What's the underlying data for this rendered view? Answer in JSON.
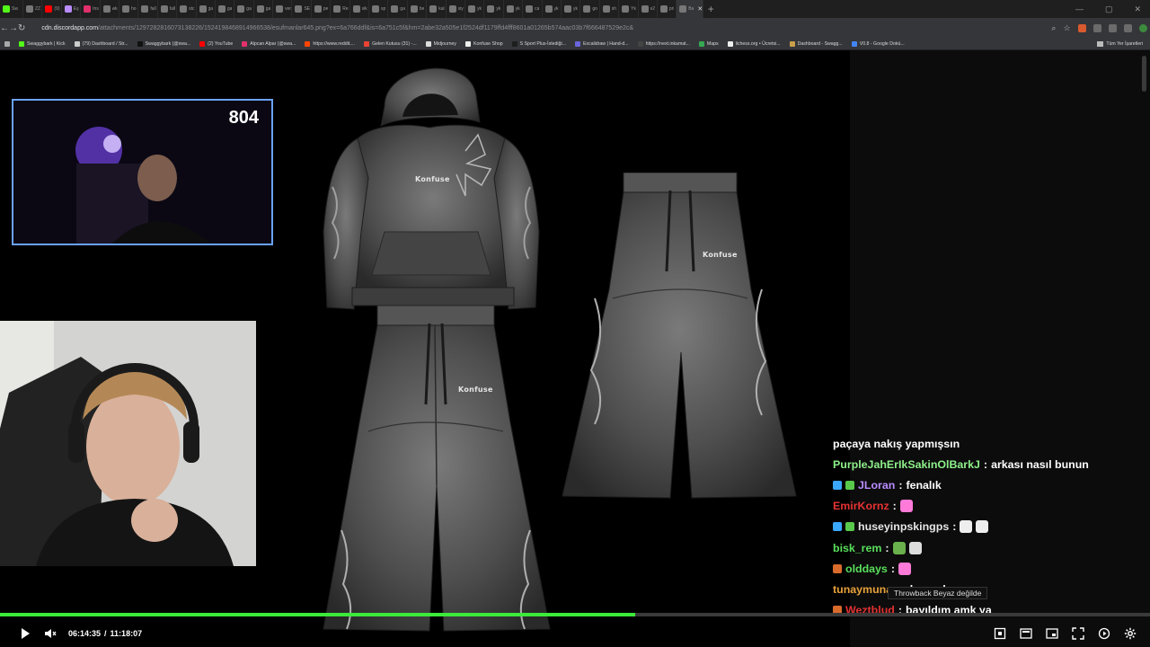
{
  "browser": {
    "tabs": [
      {
        "label": "Sw",
        "icon": "kick-icon",
        "color": "#53fc18"
      },
      {
        "label": "ZZ",
        "icon": "globe-icon",
        "color": "#777777"
      },
      {
        "label": "(9)",
        "icon": "youtube-icon",
        "color": "#ff0000"
      },
      {
        "label": "Eş",
        "icon": "feather-icon",
        "color": "#b98cff"
      },
      {
        "label": "Ins",
        "icon": "instagram-icon",
        "color": "#e1306c"
      },
      {
        "label": "wk",
        "icon": "globe-icon",
        "color": "#777777"
      },
      {
        "label": "ho",
        "icon": "globe-icon",
        "color": "#777777"
      },
      {
        "label": "fall",
        "icon": "globe-icon",
        "color": "#777777"
      },
      {
        "label": "fall",
        "icon": "globe-icon",
        "color": "#777777"
      },
      {
        "label": "stc",
        "icon": "globe-icon",
        "color": "#777777"
      },
      {
        "label": "ga",
        "icon": "globe-icon",
        "color": "#777777"
      },
      {
        "label": "ga",
        "icon": "globe-icon",
        "color": "#777777"
      },
      {
        "label": "ga",
        "icon": "globe-icon",
        "color": "#777777"
      },
      {
        "label": "ga",
        "icon": "globe-icon",
        "color": "#777777"
      },
      {
        "label": "ver",
        "icon": "globe-icon",
        "color": "#777777"
      },
      {
        "label": "SE",
        "icon": "globe-icon",
        "color": "#777777"
      },
      {
        "label": "pe",
        "icon": "globe-icon",
        "color": "#777777"
      },
      {
        "label": "Re",
        "icon": "globe-icon",
        "color": "#777777"
      },
      {
        "label": "sik",
        "icon": "globe-icon",
        "color": "#777777"
      },
      {
        "label": "sp",
        "icon": "globe-icon",
        "color": "#777777"
      },
      {
        "label": "ga",
        "icon": "globe-icon",
        "color": "#777777"
      },
      {
        "label": "be",
        "icon": "globe-icon",
        "color": "#777777"
      },
      {
        "label": "kal",
        "icon": "globe-icon",
        "color": "#777777"
      },
      {
        "label": "siy",
        "icon": "globe-icon",
        "color": "#777777"
      },
      {
        "label": "yk",
        "icon": "globe-icon",
        "color": "#777777"
      },
      {
        "label": "yk",
        "icon": "globe-icon",
        "color": "#777777"
      },
      {
        "label": "yk",
        "icon": "globe-icon",
        "color": "#777777"
      },
      {
        "label": "ca",
        "icon": "globe-icon",
        "color": "#777777"
      },
      {
        "label": "yk",
        "icon": "globe-icon",
        "color": "#777777"
      },
      {
        "label": "yk",
        "icon": "globe-icon",
        "color": "#777777"
      },
      {
        "label": "go",
        "icon": "globe-icon",
        "color": "#777777"
      },
      {
        "label": "sh",
        "icon": "globe-icon",
        "color": "#777777"
      },
      {
        "label": "Yk",
        "icon": "globe-icon",
        "color": "#777777"
      },
      {
        "label": "e2",
        "icon": "globe-icon",
        "color": "#777777"
      },
      {
        "label": "pri",
        "icon": "globe-icon",
        "color": "#777777"
      },
      {
        "label": "Ba",
        "icon": "globe-icon",
        "color": "#777777"
      }
    ],
    "active_tab_close": "✕",
    "new_tab": "+",
    "url_host": "cdn.discordapp.com",
    "url_path": "/attachments/1297282816073138226/1524198468914966538/esufmanlar645.png?ex=6a766ddf&is=6a751c5f&hm=2abe32a505e1f2524df1179ffd4fff8601a01265b574aac03b7f666487529e2c&",
    "bookmarks": [
      {
        "label": "Swaggybark | Kick",
        "color": "#53fc18"
      },
      {
        "label": "(79) Dashboard / Str...",
        "color": "#cccccc"
      },
      {
        "label": "Swaggybark (@swa...",
        "color": "#111111"
      },
      {
        "label": "(2) YouTube",
        "color": "#ff0000"
      },
      {
        "label": "Alpcan Alpar (@swa...",
        "color": "#e1306c"
      },
      {
        "label": "https://www.reddit....",
        "color": "#ff4500"
      },
      {
        "label": "Gelen Kutusu (31) -...",
        "color": "#ea4335"
      },
      {
        "label": "Midjourney",
        "color": "#dddddd"
      },
      {
        "label": "Konfuse Shop",
        "color": "#eeeeee"
      },
      {
        "label": "S Sport Plus-İstediği...",
        "color": "#1e1e1e"
      },
      {
        "label": "Excalidraw | Hand-d...",
        "color": "#6965db"
      },
      {
        "label": "https://next.inkamat...",
        "color": "#444444"
      },
      {
        "label": "Maps",
        "color": "#34a853"
      },
      {
        "label": "lichess.org • Ücretsi...",
        "color": "#eeeeee"
      },
      {
        "label": "Dashboard - Swagg...",
        "color": "#c9a04a"
      },
      {
        "label": "V0.8 - Google Dokü...",
        "color": "#4285f4"
      }
    ],
    "all_bookmarks_label": "Tüm Yer İşaretleri"
  },
  "product": {
    "brand_text": "Konfuse",
    "colors": {
      "fabric": "#4a4a4a",
      "fabric_light": "#6d6d6d",
      "fabric_dark": "#2c2c2c"
    }
  },
  "stream": {
    "viewer_count": "804",
    "cam1_border": "#6aa2ff"
  },
  "chat": {
    "partial_line": "paçaya nakış yapmışsın",
    "messages": [
      {
        "user": "PurpleJahErIkSakinOlBarkJ",
        "color": "#8ef08a",
        "badges": [],
        "text": "arkası nasıl bunun",
        "emotes": []
      },
      {
        "user": "JLoran",
        "color": "#b98cff",
        "badges": [
          "#3aa8ff",
          "#58c94b"
        ],
        "text": "fenalık",
        "emotes": []
      },
      {
        "user": "EmirKornz",
        "color": "#e63232",
        "badges": [],
        "text": "",
        "emotes": [
          "#ff7ad9"
        ]
      },
      {
        "user": "huseyinpskingps",
        "color": "#e6e6e6",
        "badges": [
          "#3aa8ff",
          "#58c94b"
        ],
        "text": "",
        "emotes": [
          "#eeeeee",
          "#eeeeee"
        ]
      },
      {
        "user": "bisk_rem",
        "color": "#59e05b",
        "badges": [],
        "text": "",
        "emotes": [
          "#6ab04c",
          "#dddddd"
        ]
      },
      {
        "user": "olddays",
        "color": "#59e05b",
        "badges": [
          "#d86b2b"
        ],
        "text": "",
        "emotes": [
          "#ff7ad9"
        ]
      },
      {
        "user": "tunaymuna",
        "color": "#e8a23a",
        "badges": [],
        "text": "olmuş dayı",
        "emotes": []
      },
      {
        "user": "Weztblud",
        "color": "#e63232",
        "badges": [
          "#d86b2b"
        ],
        "text": "bayıldım amk ya",
        "emotes": []
      }
    ],
    "tooltip": "Throwback  Beyaz değilde"
  },
  "player": {
    "current_time": "06:14:35",
    "separator": "/",
    "total_time": "11:18:07",
    "progress_fraction": 0.552,
    "progress_color": "#3bea3b"
  }
}
